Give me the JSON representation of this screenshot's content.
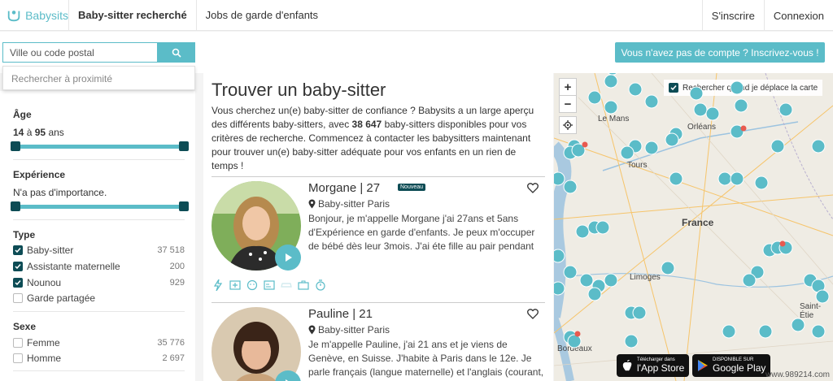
{
  "header": {
    "logo_text": "Babysits",
    "nav": [
      "Baby-sitter recherché",
      "Jobs de garde d'enfants"
    ],
    "signup": "S'inscrire",
    "login": "Connexion"
  },
  "search": {
    "placeholder": "Ville ou code postal",
    "suggestion": "Rechercher à proximité"
  },
  "cta": "Vous n'avez pas de compte ? Inscrivez-vous !",
  "filters": {
    "age": {
      "title": "Âge",
      "min": "14",
      "max": "95",
      "between": "à",
      "unit": "ans"
    },
    "experience": {
      "title": "Expérience",
      "value": "N'a pas d'importance."
    },
    "type": {
      "title": "Type",
      "options": [
        {
          "label": "Baby-sitter",
          "count": "37 518",
          "checked": true
        },
        {
          "label": "Assistante maternelle",
          "count": "200",
          "checked": true
        },
        {
          "label": "Nounou",
          "count": "929",
          "checked": true
        },
        {
          "label": "Garde partagée",
          "count": "",
          "checked": false
        }
      ]
    },
    "sexe": {
      "title": "Sexe",
      "options": [
        {
          "label": "Femme",
          "count": "35 776",
          "checked": false
        },
        {
          "label": "Homme",
          "count": "2 697",
          "checked": false
        }
      ]
    }
  },
  "main": {
    "title": "Trouver un baby-sitter",
    "intro_1": "Vous cherchez un(e) baby-sitter de confiance ? Babysits a un large aperçu des différents baby-sitters, avec ",
    "intro_count": "38 647",
    "intro_2": " baby-sitters disponibles pour vos critères de recherche. Commencez à contacter les babysitters maintenant pour trouver un(e) baby-sitter adéquate pour vos enfants en un rien de temps !",
    "cards": [
      {
        "name": "Morgane | 27",
        "badge": "Nouveau",
        "location": "Baby-sitter Paris",
        "description": "Bonjour, je m'appelle Morgane j'ai 27ans et 5ans d'Expérience en garde d'enfants. Je peux m'occuper de bébé dès leur 3mois. J'ai éte fille au pair pendant"
      },
      {
        "name": "Pauline | 21",
        "location": "Baby-sitter Paris",
        "description": "Je m'appelle Pauline, j'ai 21 ans et je viens de Genève, en Suisse. J'habite à Paris dans le 12e. Je parle français (langue maternelle) et l'anglais (courant,"
      }
    ]
  },
  "map": {
    "checkbox_label": "Rechercher quand je déplace la carte",
    "labels": {
      "lemans": "Le Mans",
      "orleans": "Orléans",
      "tours": "Tours",
      "france": "France",
      "limoges": "Limoges",
      "saintetienne": "Saint-Étie",
      "bordeaux": "Bordeaux"
    },
    "appstore_small": "Télécharger dans",
    "appstore_big": "l'App Store",
    "googleplay_small": "DISPONIBLE SUR",
    "googleplay_big": "Google Play"
  },
  "watermark": "www.989214.com",
  "colors": {
    "accent": "#5bbcc8",
    "dark": "#0d4c55"
  }
}
